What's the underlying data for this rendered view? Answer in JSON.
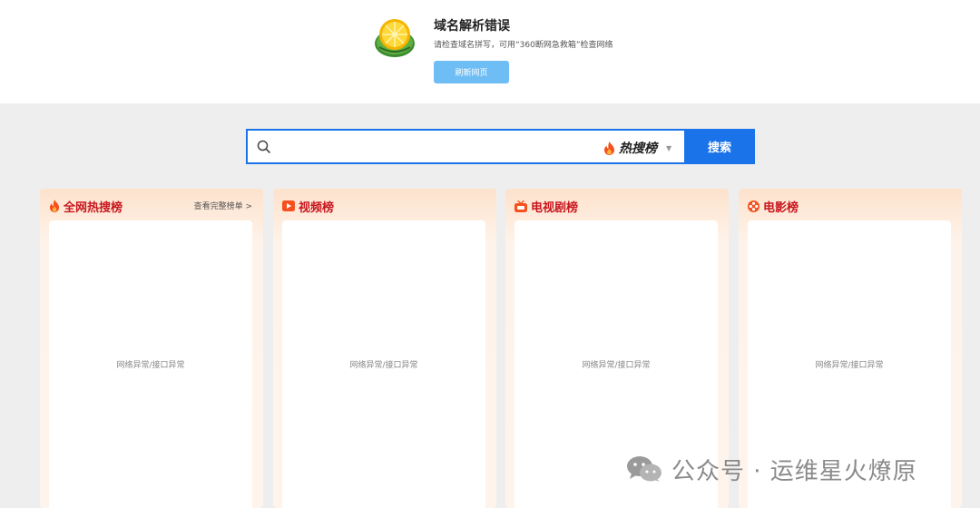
{
  "error": {
    "title": "域名解析错误",
    "description": "请检查域名拼写，可用“360断网急救箱”检查网络",
    "refresh_label": "刷新网页"
  },
  "search": {
    "placeholder": "",
    "source_label": "热搜榜",
    "button_label": "搜索"
  },
  "cards": [
    {
      "title": "全网热搜榜",
      "icon": "flame-icon",
      "more_label": "查看完整榜单 >",
      "status": "网络异常/接口异常"
    },
    {
      "title": "视频榜",
      "icon": "play-icon",
      "status": "网络异常/接口异常"
    },
    {
      "title": "电视剧榜",
      "icon": "tv-icon",
      "status": "网络异常/接口异常"
    },
    {
      "title": "电影榜",
      "icon": "film-reel-icon",
      "status": "网络异常/接口异常"
    }
  ],
  "watermark": {
    "text": "公众号 · 运维星火燎原",
    "icon": "wechat-icon"
  },
  "colors": {
    "accent": "#1a73e8",
    "refresh_button": "#6fbdf5",
    "card_title": "#c8161e",
    "icon_orange": "#f4511e"
  }
}
